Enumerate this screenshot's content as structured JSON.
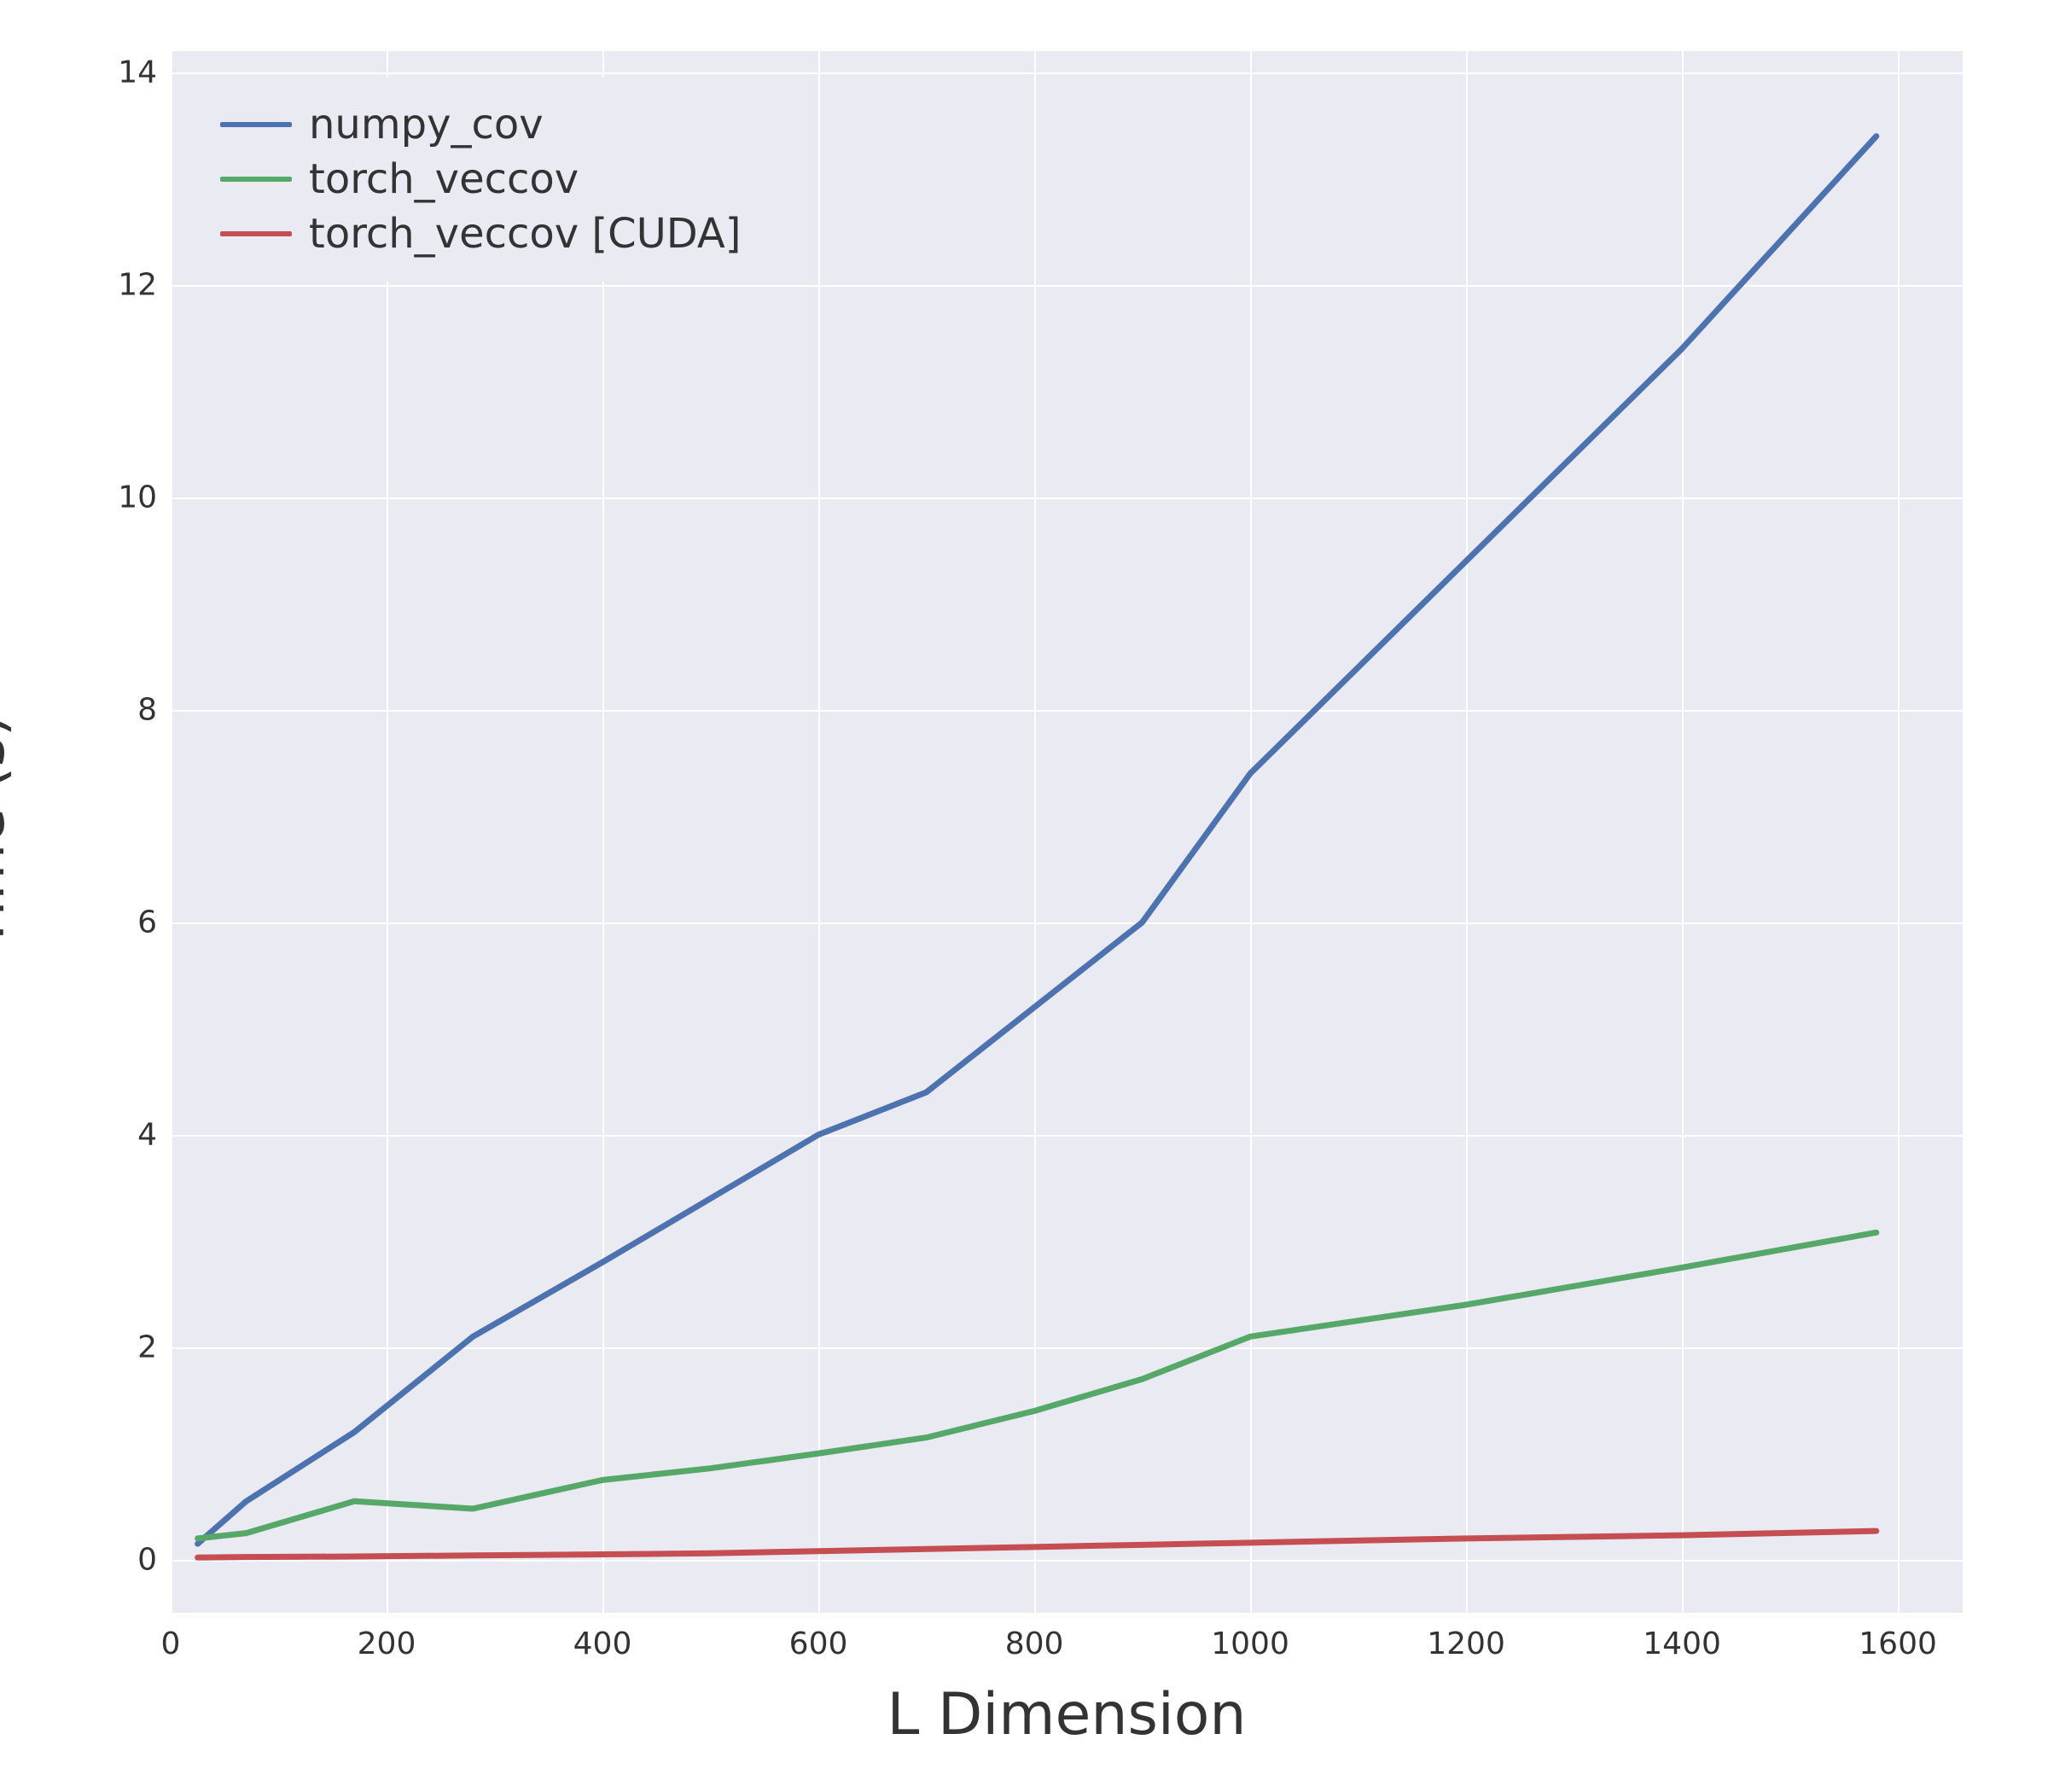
{
  "chart_data": {
    "type": "line",
    "xlabel": "L Dimension",
    "ylabel": "Time (s)",
    "xlim": [
      0,
      1660
    ],
    "ylim": [
      -0.5,
      14.2
    ],
    "xticks": [
      0,
      200,
      400,
      600,
      800,
      1000,
      1200,
      1400,
      1600
    ],
    "yticks": [
      0,
      2,
      4,
      6,
      8,
      10,
      12,
      14
    ],
    "x": [
      25,
      70,
      170,
      280,
      400,
      500,
      600,
      700,
      800,
      900,
      1000,
      1200,
      1400,
      1580
    ],
    "series": [
      {
        "name": "numpy_cov",
        "color": "#4c72b0",
        "values": [
          0.15,
          0.55,
          1.2,
          2.1,
          2.8,
          3.4,
          4.0,
          4.4,
          5.2,
          6.0,
          7.4,
          9.4,
          11.4,
          13.4
        ]
      },
      {
        "name": "torch_veccov",
        "color": "#55a868",
        "values": [
          0.2,
          0.25,
          0.55,
          0.48,
          0.75,
          0.86,
          1.0,
          1.15,
          1.4,
          1.7,
          2.1,
          2.4,
          2.75,
          3.08
        ]
      },
      {
        "name": "torch_veccov [CUDA]",
        "color": "#c44e52",
        "values": [
          0.02,
          0.025,
          0.03,
          0.04,
          0.05,
          0.06,
          0.08,
          0.1,
          0.12,
          0.14,
          0.16,
          0.2,
          0.23,
          0.27
        ]
      }
    ]
  }
}
